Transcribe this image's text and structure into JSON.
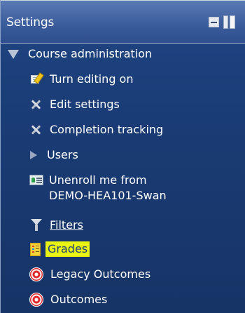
{
  "block": {
    "title": "Settings"
  },
  "tree": {
    "section_label": "Course administration",
    "items": [
      {
        "label": "Turn editing on"
      },
      {
        "label": "Edit settings"
      },
      {
        "label": "Completion tracking"
      },
      {
        "label": "Users"
      },
      {
        "label_line1": "Unenroll me from",
        "label_line2": "DEMO-HEA101-Swan"
      },
      {
        "label": "Filters"
      },
      {
        "label": "Grades"
      },
      {
        "label": "Legacy Outcomes"
      },
      {
        "label": "Outcomes"
      }
    ]
  },
  "colors": {
    "background": "#1d3f7a",
    "highlight": "#e8f313",
    "text": "#ffffff"
  },
  "icons": {
    "dock": "minus-icon",
    "hide": "panel-icon",
    "section": "triangle-down-icon",
    "edit": "pencil-page-icon",
    "settings": "tools-icon",
    "users": "triangle-right-icon",
    "unenroll": "user-card-icon",
    "filters": "funnel-icon",
    "grades": "grades-icon",
    "outcomes": "target-icon"
  }
}
